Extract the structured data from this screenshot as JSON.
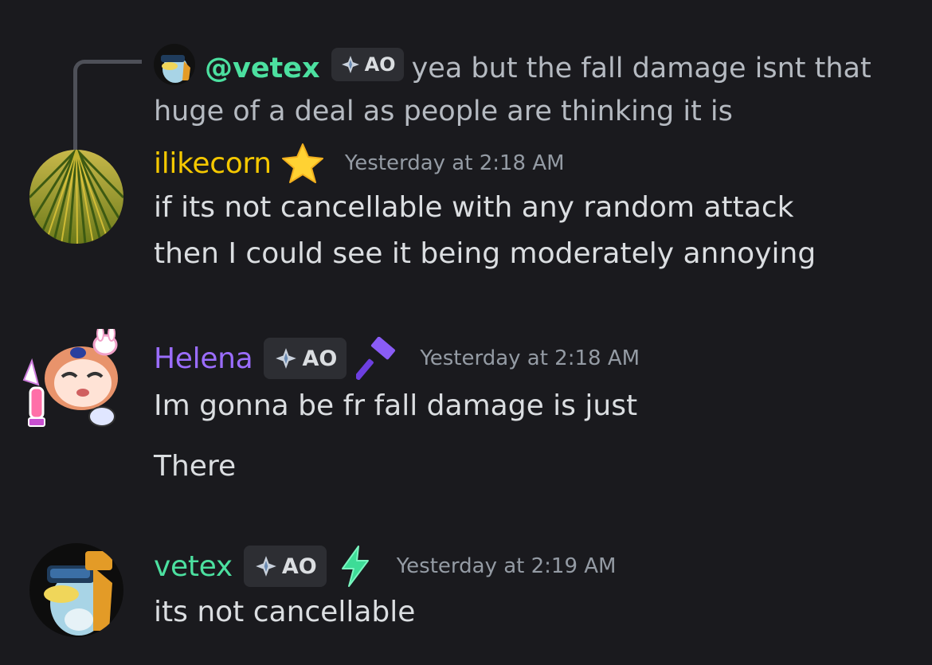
{
  "reply": {
    "username": "@vetex",
    "tag": "AO",
    "text": "yea but the fall damage isnt that huge of a deal as people are thinking it is"
  },
  "messages": [
    {
      "username": "ilikecorn",
      "name_color": "#f5c800",
      "badge_icon": "star-icon",
      "timestamp": "Yesterday at 2:18 AM",
      "lines": [
        "if its not cancellable with any random attack",
        "then I could see it being moderately annoying"
      ]
    },
    {
      "username": "Helena",
      "name_color": "#9b6dff",
      "tag": "AO",
      "badge_icon": "hammer-icon",
      "timestamp": "Yesterday at 2:18 AM",
      "lines": [
        "Im gonna be fr fall damage is just",
        "There"
      ]
    },
    {
      "username": "vetex",
      "name_color": "#4ce0a0",
      "tag": "AO",
      "badge_icon": "lightning-icon",
      "timestamp": "Yesterday at 2:19 AM",
      "lines": [
        "its not cancellable"
      ]
    }
  ],
  "colors": {
    "background": "#1a1a1e",
    "text": "#dbdee1",
    "muted": "#949ba4",
    "tag_bg": "#2d2e33"
  }
}
